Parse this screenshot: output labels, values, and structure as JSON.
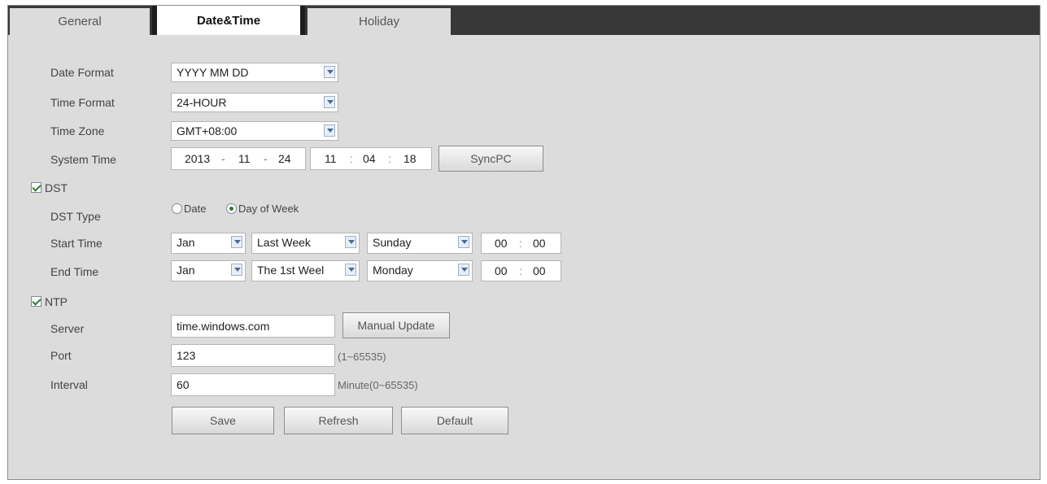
{
  "tabs": [
    "General",
    "Date&Time",
    "Holiday"
  ],
  "labels": {
    "date_format": "Date Format",
    "time_format": "Time Format",
    "time_zone": "Time Zone",
    "system_time": "System Time",
    "dst": "DST",
    "dst_type": "DST Type",
    "start_time": "Start Time",
    "end_time": "End Time",
    "ntp": "NTP",
    "server": "Server",
    "port": "Port",
    "interval": "Interval"
  },
  "values": {
    "date_format": "YYYY MM DD",
    "time_format": "24-HOUR",
    "time_zone": "GMT+08:00"
  },
  "system_time": {
    "year": "2013",
    "month": "11",
    "day": "24",
    "hour": "11",
    "minute": "04",
    "second": "18",
    "date_sep": "-",
    "time_sep": ":"
  },
  "buttons": {
    "sync_pc": "SyncPC",
    "manual_update": "Manual Update",
    "save": "Save",
    "refresh": "Refresh",
    "default": "Default"
  },
  "dst_type": {
    "date": "Date",
    "day_of_week": "Day of Week",
    "selected": "day_of_week"
  },
  "start": {
    "month": "Jan",
    "week": "Last Week",
    "day": "Sunday",
    "hour": "00",
    "minute": "00"
  },
  "end": {
    "month": "Jan",
    "week": "The 1st Weel",
    "day": "Monday",
    "hour": "00",
    "minute": "00"
  },
  "ntp": {
    "server": "time.windows.com",
    "port": "123",
    "port_hint": "(1~65535)",
    "interval": "60",
    "interval_hint": "Minute(0~65535)"
  },
  "checkboxes": {
    "dst_checked": true,
    "ntp_checked": true
  }
}
